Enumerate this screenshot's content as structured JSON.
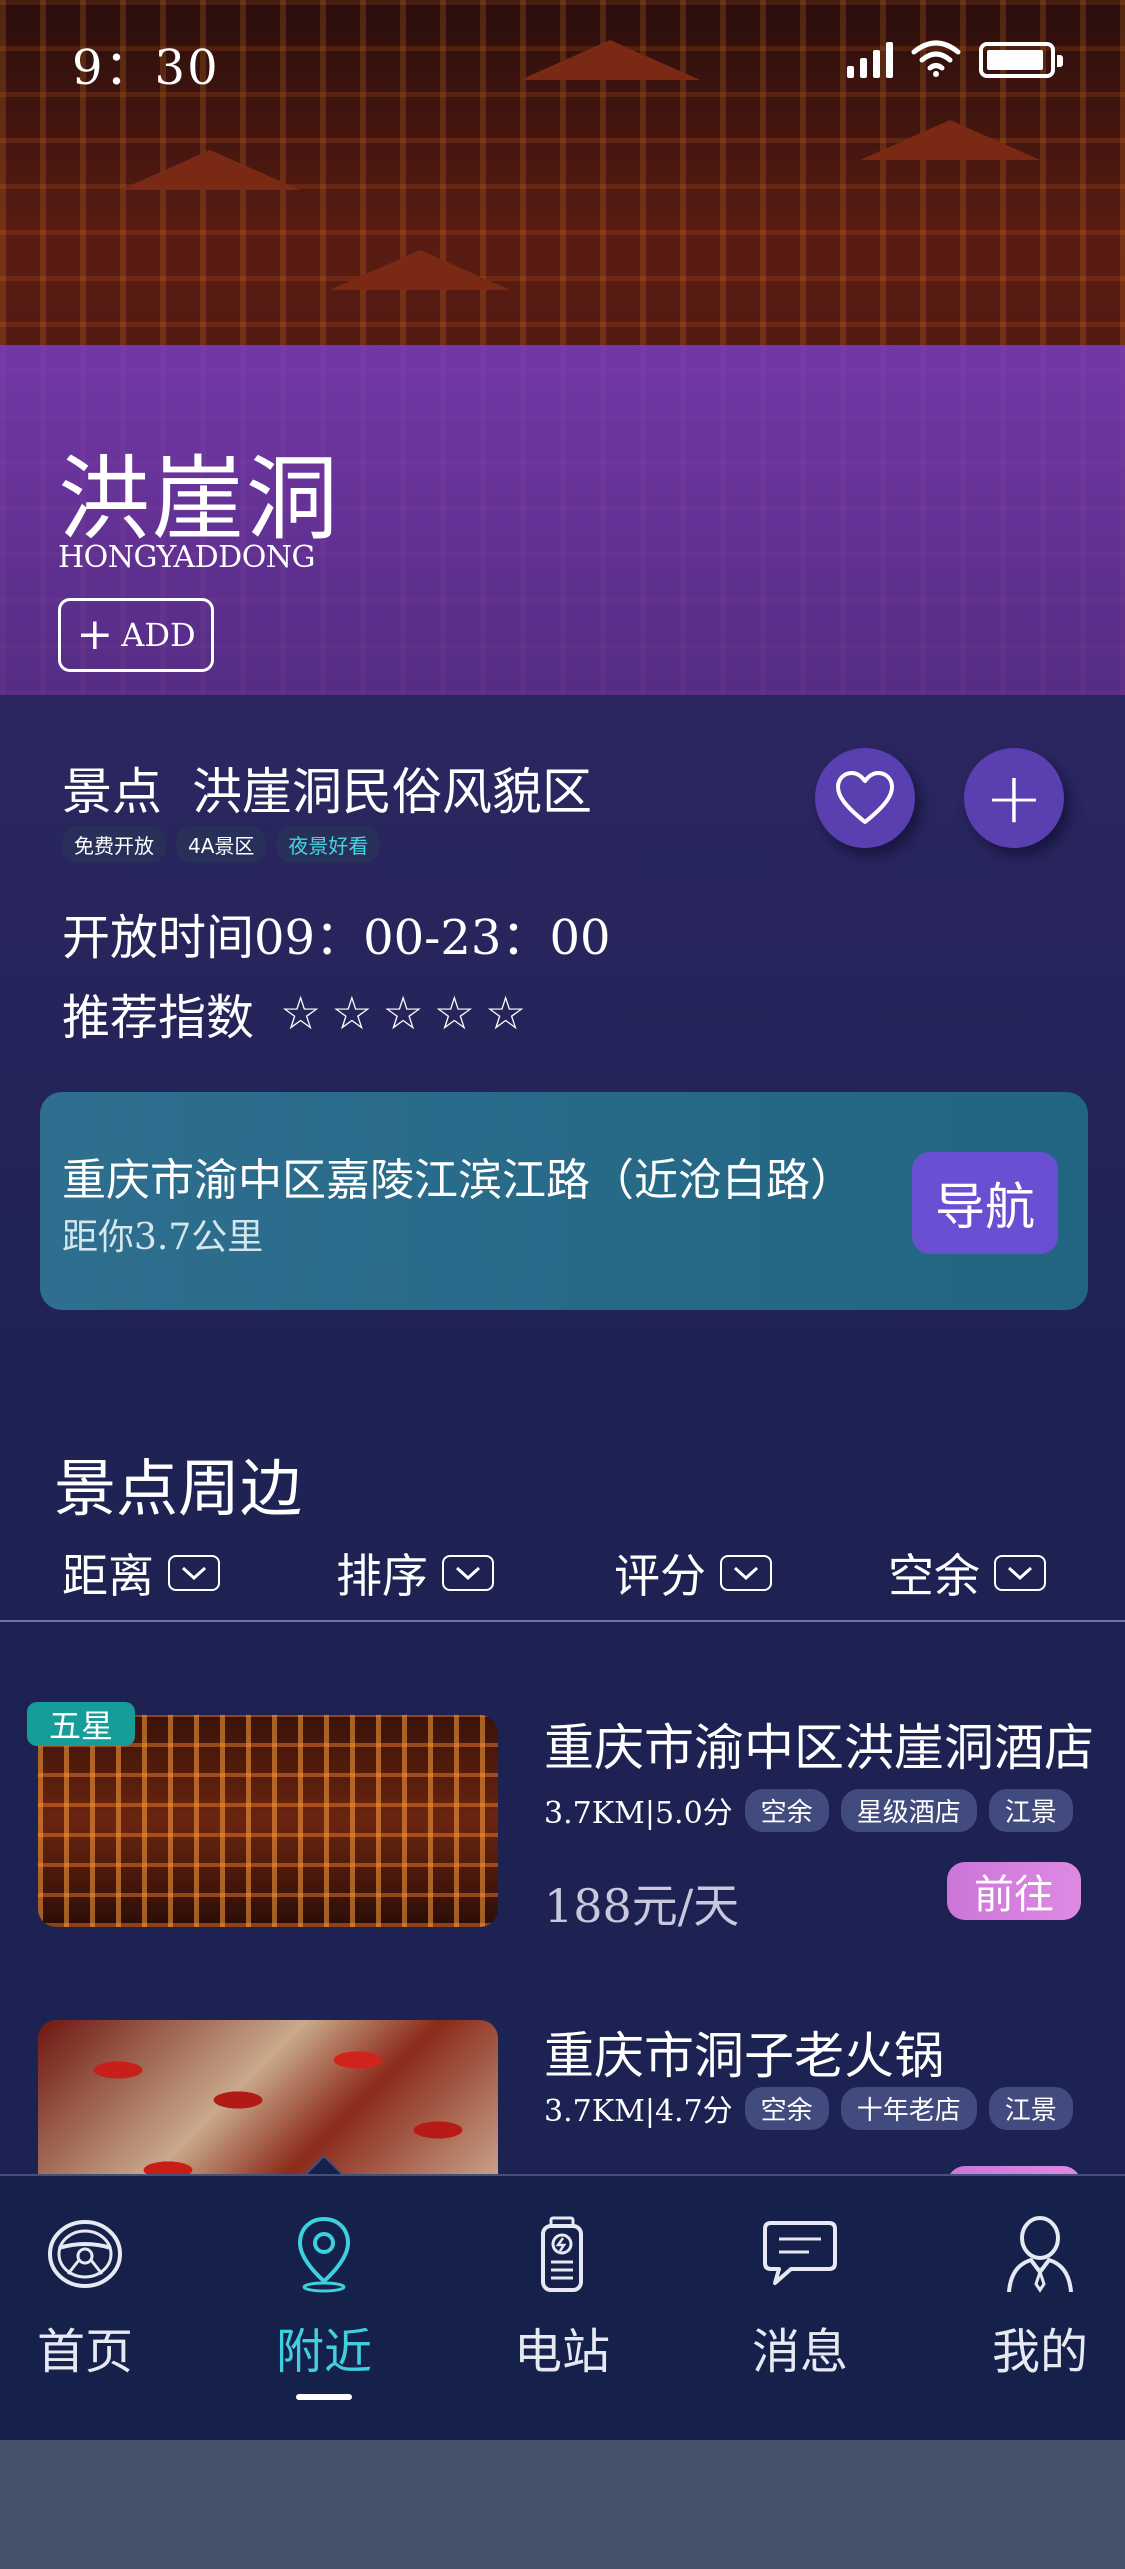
{
  "status_bar": {
    "time": "9：30"
  },
  "hero": {
    "title": "洪崖洞",
    "subtitle": "HONGYADDONG",
    "add_label": "ADD"
  },
  "attraction": {
    "type_label": "景点",
    "name": "洪崖洞民俗风貌区",
    "tags": [
      "免费开放",
      "4A景区",
      "夜景好看"
    ],
    "open_label": "开放时间",
    "open_value": "09：00-23：00",
    "rating_label": "推荐指数",
    "rating_stars": 5
  },
  "address": {
    "text": "重庆市渝中区嘉陵江滨江路（近沧白路）",
    "distance_prefix": "距你",
    "distance_value": "3.7",
    "distance_unit": "公里",
    "nav_label": "导航"
  },
  "nearby": {
    "title": "景点周边",
    "filters": [
      "距离",
      "排序",
      "评分",
      "空余"
    ],
    "items": [
      {
        "badge": "五星",
        "name": "重庆市渝中区洪崖洞酒店",
        "stat": "3.7KM|5.0分",
        "chips": [
          "空余",
          "星级酒店",
          "江景"
        ],
        "price": "188元/天",
        "go_label": "前往"
      },
      {
        "name": "重庆市洞子老火锅",
        "stat": "3.7KM|4.7分",
        "chips": [
          "空余",
          "十年老店",
          "江景"
        ]
      }
    ]
  },
  "tabbar": {
    "tabs": [
      {
        "label": "首页",
        "icon": "steering-wheel-icon"
      },
      {
        "label": "附近",
        "icon": "location-pin-icon",
        "active": true
      },
      {
        "label": "电站",
        "icon": "battery-station-icon"
      },
      {
        "label": "消息",
        "icon": "message-icon"
      },
      {
        "label": "我的",
        "icon": "user-icon"
      }
    ]
  },
  "colors": {
    "accent_purple": "#6b4fd3",
    "active_tab": "#3fd0de",
    "go_button": "#d67fdf",
    "badge_teal": "#169d9a"
  }
}
